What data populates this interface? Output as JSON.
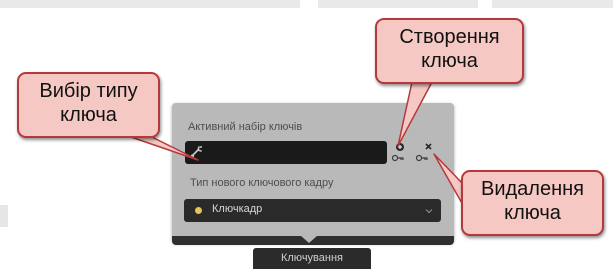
{
  "panel": {
    "keyset_label": "Активний набір ключів",
    "keyset_value": "",
    "frametype_label": "Тип нового ключового кадру",
    "frametype_value": "Ключкадр",
    "footer_tab": "Ключування"
  },
  "icons": {
    "keyset": "key-icon",
    "add": "add-key-icon",
    "delete": "delete-key-icon",
    "frametype": "keyframe-dot-icon",
    "dropdown": "chevron-down-icon"
  },
  "callouts": {
    "type": [
      "Вибір типу",
      "ключа"
    ],
    "create": [
      "Створення",
      "ключа"
    ],
    "delete": [
      "Видалення",
      "ключа"
    ]
  },
  "colors": {
    "callout_fill": "#f5c8c4",
    "callout_border": "#b5393c",
    "panel_bg": "#b9b9b9",
    "field_bg": "#1a1a1a",
    "keyframe_dot": "#e8c35a"
  }
}
